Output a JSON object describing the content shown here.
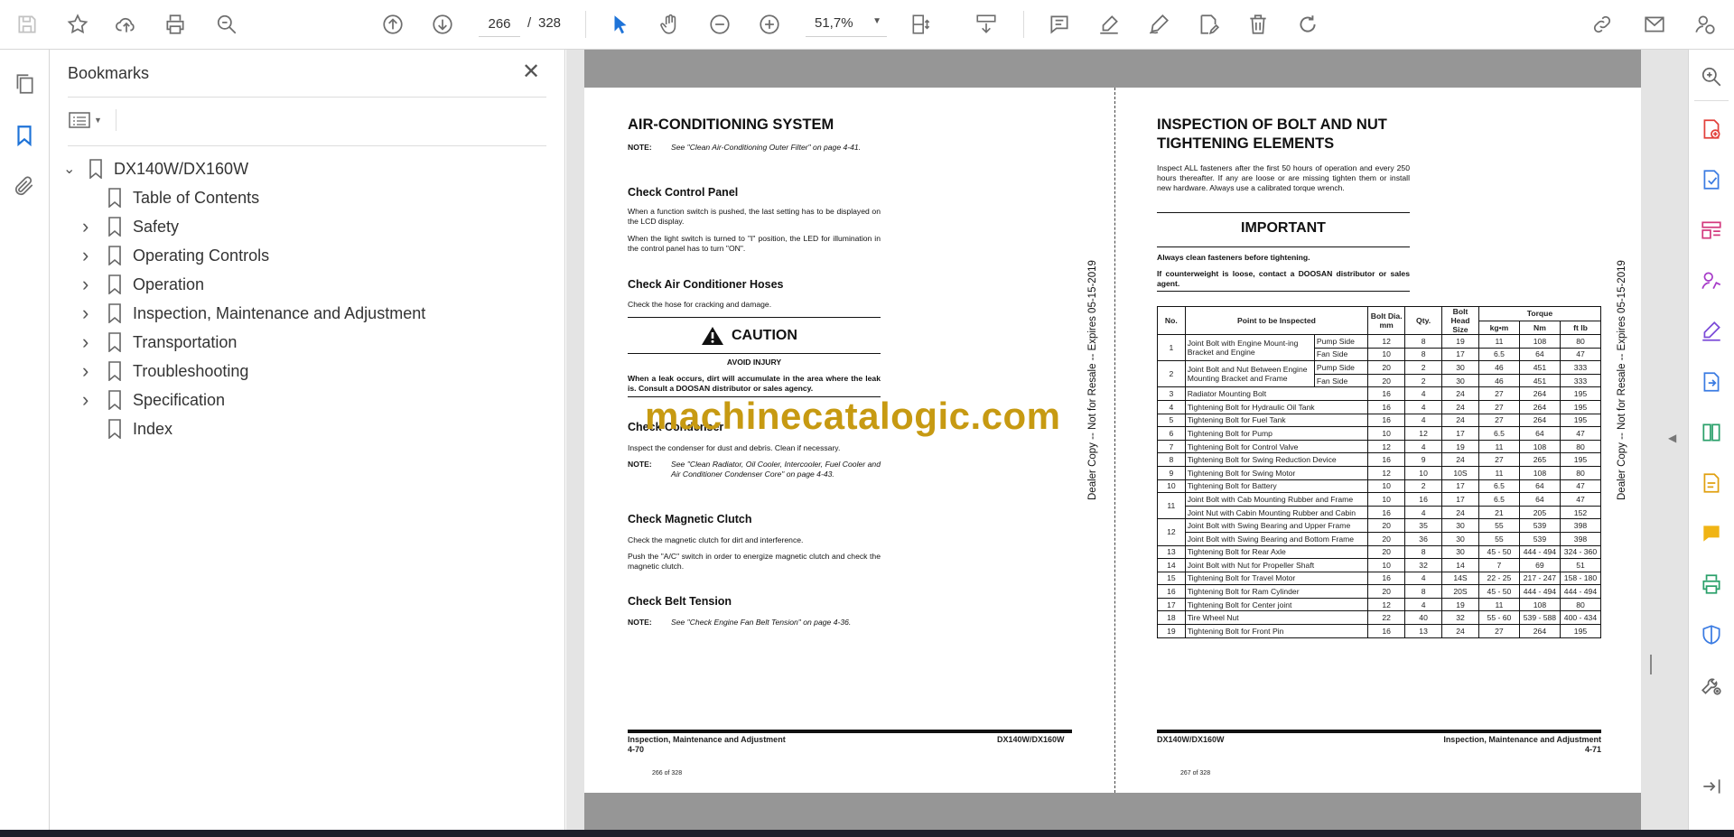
{
  "toolbar": {
    "page_current": "266",
    "page_sep": "/",
    "page_total": "328",
    "zoom": "51,7%"
  },
  "bookmarks": {
    "title": "Bookmarks",
    "root": "DX140W/DX160W",
    "items": [
      {
        "label": "Table of Contents",
        "expandable": false
      },
      {
        "label": "Safety",
        "expandable": true
      },
      {
        "label": "Operating Controls",
        "expandable": true
      },
      {
        "label": "Operation",
        "expandable": true
      },
      {
        "label": "Inspection, Maintenance and Adjustment",
        "expandable": true
      },
      {
        "label": "Transportation",
        "expandable": true
      },
      {
        "label": "Troubleshooting",
        "expandable": true
      },
      {
        "label": "Specification",
        "expandable": true
      },
      {
        "label": "Index",
        "expandable": false
      }
    ]
  },
  "left_page": {
    "title": "AIR-CONDITIONING SYSTEM",
    "note1_label": "NOTE:",
    "note1": "See \"Clean Air-Conditioning Outer Filter\" on page 4-41.",
    "s1_title": "Check Control Panel",
    "s1_p1": "When a function switch is pushed, the last setting has to be displayed on the LCD display.",
    "s1_p2": "When the light switch is turned to \"I\" position, the LED for illumination in the control panel has to turn \"ON\".",
    "s2_title": "Check Air Conditioner Hoses",
    "s2_p1": "Check the hose for cracking and damage.",
    "caution_title": "CAUTION",
    "caution_sub": "AVOID INJURY",
    "caution_text": "When a leak occurs, dirt will accumulate in the area where the leak is. Consult a DOOSAN distributor or sales agency.",
    "s3_title": "Check Condenser",
    "s3_p1": "Inspect the condenser for dust and debris. Clean if necessary.",
    "note2_label": "NOTE:",
    "note2": "See \"Clean Radiator, Oil Cooler, Intercooler, Fuel Cooler and Air Conditioner Condenser Core\" on page 4-43.",
    "s4_title": "Check Magnetic Clutch",
    "s4_p1": "Check the magnetic clutch for dirt and interference.",
    "s4_p2": "Push the \"A/C\" switch in order to energize magnetic clutch and check the magnetic clutch.",
    "s5_title": "Check Belt Tension",
    "note3_label": "NOTE:",
    "note3": "See \"Check Engine Fan Belt Tension\" on page 4-36.",
    "footer_left": "Inspection, Maintenance and Adjustment",
    "footer_left2": "4-70",
    "footer_right": "DX140W/DX160W",
    "page_of": "266 of 328",
    "side_text": "Dealer Copy -- Not for Resale -- Expires 05-15-2019"
  },
  "right_page": {
    "title_l1": "INSPECTION OF BOLT AND NUT",
    "title_l2": "TIGHTENING ELEMENTS",
    "intro": "Inspect ALL fasteners after the first 50 hours of operation and every 250 hours thereafter. If any are loose or are missing tighten them or install new hardware. Always use a calibrated torque wrench.",
    "important_title": "IMPORTANT",
    "imp1": "Always clean fasteners before tightening.",
    "imp2": "If counterweight is loose, contact a DOOSAN distributor or sales agent.",
    "table_headers": {
      "no": "No.",
      "point": "Point to be Inspected",
      "dia": "Bolt Dia. mm",
      "qty": "Qty.",
      "head": "Bolt Head Size",
      "torque": "Torque",
      "kgm": "kg•m",
      "nm": "Nm",
      "ftlb": "ft lb"
    },
    "footer_left": "DX140W/DX160W",
    "footer_right": "Inspection, Maintenance and Adjustment",
    "footer_right2": "4-71",
    "page_of": "267 of 328",
    "side_text": "Dealer Copy -- Not for Resale -- Expires 05-15-2019"
  },
  "watermark": "machinecatalogic.com",
  "rows": [
    {
      "no": "1",
      "point": "Joint Bolt with Engine Mount-ing Bracket and Engine",
      "sub": [
        "Pump Side",
        "Fan Side"
      ],
      "vals": [
        [
          "12",
          "8",
          "19",
          "11",
          "108",
          "80"
        ],
        [
          "10",
          "8",
          "17",
          "6.5",
          "64",
          "47"
        ]
      ]
    },
    {
      "no": "2",
      "point": "Joint Bolt and Nut Between Engine Mounting Bracket and Frame",
      "sub": [
        "Pump Side",
        "Fan Side"
      ],
      "vals": [
        [
          "20",
          "2",
          "30",
          "46",
          "451",
          "333"
        ],
        [
          "20",
          "2",
          "30",
          "46",
          "451",
          "333"
        ]
      ]
    },
    {
      "no": "3",
      "point": "Radiator Mounting Bolt",
      "vals": [
        [
          "16",
          "4",
          "24",
          "27",
          "264",
          "195"
        ]
      ]
    },
    {
      "no": "4",
      "point": "Tightening Bolt for Hydraulic Oil Tank",
      "vals": [
        [
          "16",
          "4",
          "24",
          "27",
          "264",
          "195"
        ]
      ]
    },
    {
      "no": "5",
      "point": "Tightening Bolt for Fuel Tank",
      "vals": [
        [
          "16",
          "4",
          "24",
          "27",
          "264",
          "195"
        ]
      ]
    },
    {
      "no": "6",
      "point": "Tightening Bolt for Pump",
      "vals": [
        [
          "10",
          "12",
          "17",
          "6.5",
          "64",
          "47"
        ]
      ]
    },
    {
      "no": "7",
      "point": "Tightening Bolt for Control Valve",
      "vals": [
        [
          "12",
          "4",
          "19",
          "11",
          "108",
          "80"
        ]
      ]
    },
    {
      "no": "8",
      "point": "Tightening Bolt for Swing Reduction Device",
      "vals": [
        [
          "16",
          "9",
          "24",
          "27",
          "265",
          "195"
        ]
      ]
    },
    {
      "no": "9",
      "point": "Tightening Bolt for Swing Motor",
      "vals": [
        [
          "12",
          "10",
          "10S",
          "11",
          "108",
          "80"
        ]
      ]
    },
    {
      "no": "10",
      "point": "Tightening Bolt for Battery",
      "vals": [
        [
          "10",
          "2",
          "17",
          "6.5",
          "64",
          "47"
        ]
      ]
    },
    {
      "no": "11",
      "point": "Joint Bolt with Cab Mounting Rubber and Frame",
      "vals": [
        [
          "10",
          "16",
          "17",
          "6.5",
          "64",
          "47"
        ]
      ],
      "second": {
        "point": "Joint Nut with Cabin Mounting Rubber and Cabin",
        "vals": [
          "16",
          "4",
          "24",
          "21",
          "205",
          "152"
        ]
      }
    },
    {
      "no": "12",
      "point": "Joint Bolt with Swing Bearing and Upper Frame",
      "vals": [
        [
          "20",
          "35",
          "30",
          "55",
          "539",
          "398"
        ]
      ],
      "second": {
        "point": "Joint Bolt with Swing Bearing and Bottom Frame",
        "vals": [
          "20",
          "36",
          "30",
          "55",
          "539",
          "398"
        ]
      }
    },
    {
      "no": "13",
      "point": "Tightening Bolt for Rear Axle",
      "vals": [
        [
          "20",
          "8",
          "30",
          "45 - 50",
          "444 - 494",
          "324 - 360"
        ]
      ]
    },
    {
      "no": "14",
      "point": "Joint Bolt with Nut for Propeller Shaft",
      "vals": [
        [
          "10",
          "32",
          "14",
          "7",
          "69",
          "51"
        ]
      ]
    },
    {
      "no": "15",
      "point": "Tightening Bolt for Travel Motor",
      "vals": [
        [
          "16",
          "4",
          "14S",
          "22 - 25",
          "217 - 247",
          "158 - 180"
        ]
      ]
    },
    {
      "no": "16",
      "point": "Tightening Bolt for Ram Cylinder",
      "vals": [
        [
          "20",
          "8",
          "20S",
          "45 - 50",
          "444 - 494",
          "444 - 494"
        ]
      ]
    },
    {
      "no": "17",
      "point": "Tightening Bolt for Center joint",
      "vals": [
        [
          "12",
          "4",
          "19",
          "11",
          "108",
          "80"
        ]
      ]
    },
    {
      "no": "18",
      "point": "Tire Wheel Nut",
      "vals": [
        [
          "22",
          "40",
          "32",
          "55 - 60",
          "539 - 588",
          "400 - 434"
        ]
      ]
    },
    {
      "no": "19",
      "point": "Tightening Bolt for Front Pin",
      "vals": [
        [
          "16",
          "13",
          "24",
          "27",
          "264",
          "195"
        ]
      ]
    }
  ]
}
